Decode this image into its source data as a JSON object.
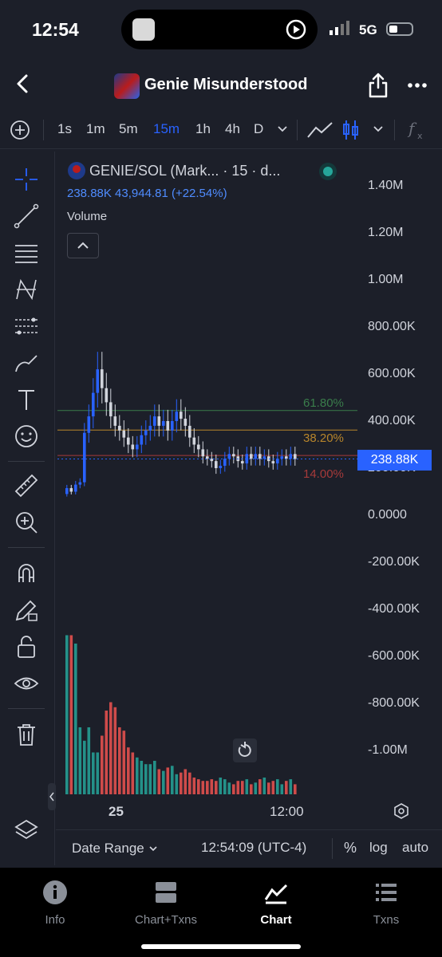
{
  "status_bar": {
    "time": "12:54",
    "network": "5G"
  },
  "header": {
    "title": "Genie Misunderstood"
  },
  "toolbar": {
    "intervals": [
      "1s",
      "1m",
      "5m",
      "15m",
      "1h",
      "4h",
      "D"
    ],
    "active_interval": "15m"
  },
  "legend": {
    "title": "GENIE/SOL (Mark... · 15 · d...",
    "values": "238.88K  43,944.81 (+22.54%)",
    "volume_label": "Volume"
  },
  "y_axis": {
    "labels": [
      "1.40M",
      "1.20M",
      "1.00M",
      "800.00K",
      "600.00K",
      "400.00K",
      "200.00K",
      "0.0000",
      "-200.00K",
      "-400.00K",
      "-600.00K",
      "-800.00K",
      "-1.00M"
    ],
    "current_price": "238.88K"
  },
  "fib_levels": [
    {
      "label": "61.80%",
      "color": "#3a7d4b"
    },
    {
      "label": "38.20%",
      "color": "#b8862b"
    },
    {
      "label": "14.00%",
      "color": "#a63a3a"
    }
  ],
  "x_axis": {
    "labels": [
      "25",
      "12:00"
    ]
  },
  "bottom_bar": {
    "date_range": "Date Range",
    "time": "12:54:09 (UTC-4)",
    "percent": "%",
    "log": "log",
    "auto": "auto"
  },
  "nav": {
    "items": [
      {
        "label": "Info",
        "icon": "info-icon",
        "active": false
      },
      {
        "label": "Chart+Txns",
        "icon": "chart-txns-icon",
        "active": false
      },
      {
        "label": "Chart",
        "icon": "chart-icon",
        "active": true
      },
      {
        "label": "Txns",
        "icon": "list-icon",
        "active": false
      }
    ]
  },
  "colors": {
    "up": "#2962ff",
    "down": "#d1d4dc",
    "vol_up": "#26a69a",
    "vol_down": "#ef5350",
    "accent": "#2962ff"
  },
  "chart_data": {
    "type": "candlestick",
    "price": {
      "open": [
        90,
        115,
        100,
        130,
        140,
        350,
        420,
        520,
        620,
        540,
        480,
        420,
        380,
        360,
        330,
        300,
        280,
        300,
        340,
        360,
        380,
        420,
        380,
        400,
        360,
        400,
        440,
        410,
        380,
        330,
        300,
        280,
        250,
        240,
        230,
        200,
        210,
        240,
        260,
        250,
        230,
        220,
        260,
        240,
        260,
        240,
        250,
        230,
        220,
        240,
        250,
        240,
        260
      ],
      "close": [
        115,
        100,
        130,
        140,
        350,
        420,
        520,
        620,
        540,
        480,
        420,
        380,
        360,
        330,
        300,
        280,
        300,
        340,
        360,
        380,
        420,
        380,
        400,
        360,
        400,
        440,
        410,
        380,
        330,
        300,
        280,
        250,
        240,
        230,
        200,
        210,
        240,
        260,
        250,
        230,
        220,
        260,
        240,
        260,
        240,
        250,
        230,
        220,
        240,
        250,
        240,
        260,
        239
      ]
    },
    "volume": [
      95,
      95,
      90,
      40,
      32,
      40,
      25,
      25,
      35,
      50,
      55,
      52,
      40,
      38,
      28,
      25,
      22,
      20,
      18,
      18,
      20,
      15,
      14,
      16,
      17,
      12,
      13,
      15,
      13,
      10,
      9,
      8,
      8,
      9,
      8,
      10,
      9,
      7,
      6,
      8,
      8,
      9,
      6,
      7,
      9,
      10,
      7,
      8,
      9,
      6,
      8,
      9,
      6
    ]
  }
}
